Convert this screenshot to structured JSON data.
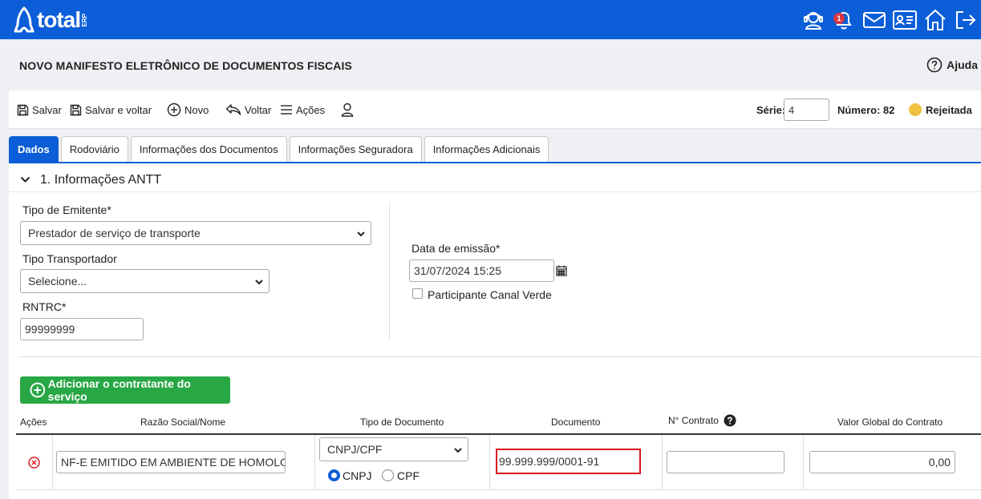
{
  "header": {
    "logo_text": "total",
    "logo_suffix": "ERP",
    "notification_count": "1",
    "icons": [
      "support-agent-icon",
      "bell-icon",
      "mail-icon",
      "id-card-icon",
      "home-icon",
      "logout-icon"
    ],
    "brand_color": "#0b5ed7"
  },
  "page": {
    "title": "NOVO MANIFESTO ELETRÔNICO DE DOCUMENTOS FISCAIS",
    "help_label": "Ajuda"
  },
  "toolbar": {
    "save_label": "Salvar",
    "save_back_label": "Salvar e voltar",
    "new_label": "Novo",
    "back_label": "Voltar",
    "actions_label": "Ações",
    "serie_label": "Série:",
    "serie_value": "4",
    "numero_label": "Número: 82",
    "status_label": "Rejeitada",
    "status_color": "#f0c040"
  },
  "tabs": [
    {
      "label": "Dados",
      "active": true
    },
    {
      "label": "Rodoviário"
    },
    {
      "label": "Informações dos Documentos"
    },
    {
      "label": "Informações Seguradora"
    },
    {
      "label": "Informações Adicionais"
    }
  ],
  "section": {
    "title": "1. Informações ANTT"
  },
  "form": {
    "tipo_emitente_label": "Tipo de Emitente*",
    "tipo_emitente_value": "Prestador de serviço de transporte",
    "tipo_transportador_label": "Tipo Transportador",
    "tipo_transportador_value": "Selecione...",
    "rntrc_label": "RNTRC*",
    "rntrc_value": "99999999",
    "data_emissao_label": "Data de emissão*",
    "data_emissao_value": "31/07/2024 15:25",
    "canal_verde_label": "Participante Canal Verde"
  },
  "contratante": {
    "add_button_label": "Adicionar o contratante do serviço",
    "columns": {
      "acoes": "Ações",
      "razao_social": "Razão Social/Nome",
      "tipo_documento": "Tipo de Documento",
      "documento": "Documento",
      "n_contrato": "N° Contrato",
      "valor_global": "Valor Global do Contrato"
    },
    "row": {
      "razao_social": "NF-E EMITIDO EM AMBIENTE DE HOMOLOGAÇÃO",
      "tipo_documento": "CNPJ/CPF",
      "radio_cnpj": "CNPJ",
      "radio_cpf": "CPF",
      "documento": "99.999.999/0001-91",
      "n_contrato": "",
      "valor_global": "0,00"
    }
  }
}
